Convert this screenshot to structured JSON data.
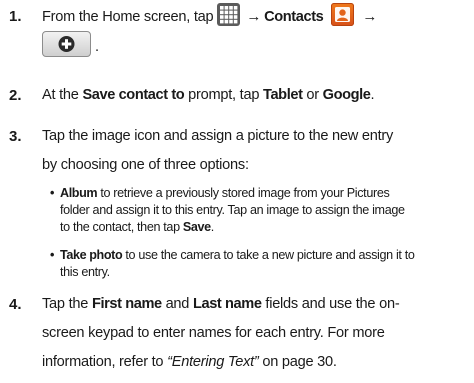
{
  "steps": [
    {
      "number": "1.",
      "line1_pre": "From the Home screen, tap",
      "arrow1": "→",
      "contacts_label": "Contacts",
      "arrow2": "→",
      "line2_suffix": ".",
      "icons": [
        "apps-grid-icon",
        "contacts-app-icon",
        "add-plus-icon"
      ]
    },
    {
      "number": "2.",
      "pre": "At the",
      "prompt_label": "Save contact to",
      "mid": "prompt, tap",
      "option1": "Tablet",
      "or": "or",
      "option2": "Google",
      "end": "."
    },
    {
      "number": "3.",
      "line1": "Tap the image icon and assign a picture to the new entry",
      "line2": "by choosing one of three options:",
      "bullets": [
        {
          "label": "Album",
          "line1_rest": "to retrieve a previously stored image from your Pictures",
          "line2": "folder and assign it to this entry. Tap an image to assign the image",
          "line3_pre": "to the contact, then tap",
          "line3_bold": "Save",
          "line3_end": "."
        },
        {
          "label": "Take photo",
          "line1_rest": "to use the camera to take a new picture and assign it to",
          "line2": "this entry."
        }
      ]
    },
    {
      "number": "4.",
      "line1_pre": "Tap the",
      "field1": "First name",
      "and": "and",
      "field2": "Last name",
      "line1_post": "fields and use the on-",
      "line2": "screen keypad to enter names for each entry. For more",
      "line3_pre": "information, refer to",
      "line3_ref": "“Entering Text”",
      "line3_post": "on page 30."
    }
  ],
  "colors": {
    "text": "#1a1a1a",
    "apps_icon_bg": "#5b5b5b",
    "contacts_icon_bg": "#e2641b",
    "plus_button_bg": "#e0e0e0"
  }
}
